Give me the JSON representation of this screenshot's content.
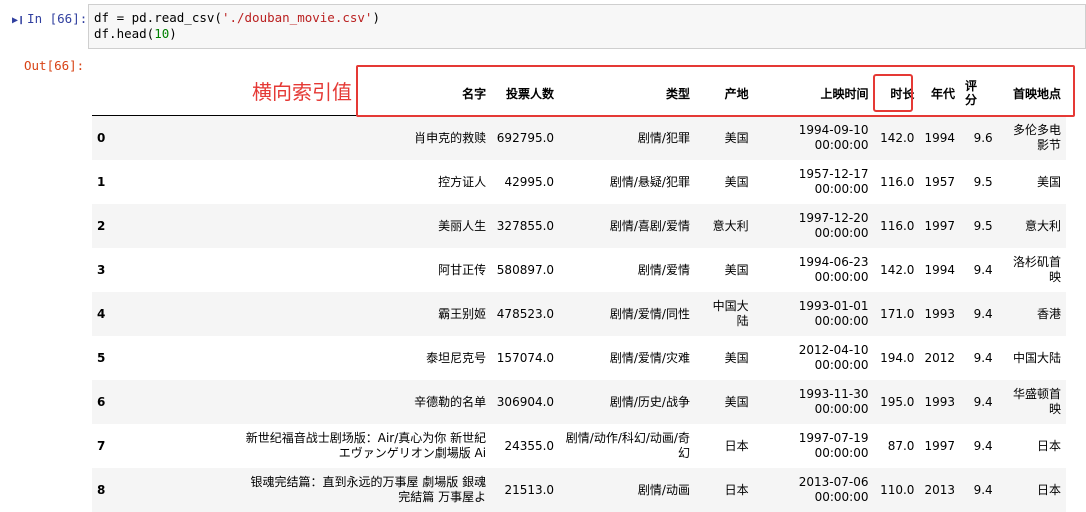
{
  "input_prompt": "In [66]:",
  "code": {
    "line1_pre": "df = pd.read_csv(",
    "line1_str": "'./douban_movie.csv'",
    "line1_post": ")",
    "line2_pre": "df.head(",
    "line2_num": "10",
    "line2_post": ")"
  },
  "output_prompt": "Out[66]:",
  "annotation": "横向索引值",
  "columns": [
    "名字",
    "投票人数",
    "类型",
    "产地",
    "上映时间",
    "时长",
    "年代",
    "评分",
    "首映地点"
  ],
  "rows": [
    {
      "idx": "0",
      "name": "肖申克的救赎",
      "votes": "692795.0",
      "genre": "剧情/犯罪",
      "origin": "美国",
      "date": "1994-09-10",
      "time": "00:00:00",
      "length": "142.0",
      "year": "1994",
      "score": "9.6",
      "premiere": "多伦多电影节"
    },
    {
      "idx": "1",
      "name": "控方证人",
      "votes": "42995.0",
      "genre": "剧情/悬疑/犯罪",
      "origin": "美国",
      "date": "1957-12-17",
      "time": "00:00:00",
      "length": "116.0",
      "year": "1957",
      "score": "9.5",
      "premiere": "美国"
    },
    {
      "idx": "2",
      "name": "美丽人生",
      "votes": "327855.0",
      "genre": "剧情/喜剧/爱情",
      "origin": "意大利",
      "date": "1997-12-20",
      "time": "00:00:00",
      "length": "116.0",
      "year": "1997",
      "score": "9.5",
      "premiere": "意大利"
    },
    {
      "idx": "3",
      "name": "阿甘正传",
      "votes": "580897.0",
      "genre": "剧情/爱情",
      "origin": "美国",
      "date": "1994-06-23",
      "time": "00:00:00",
      "length": "142.0",
      "year": "1994",
      "score": "9.4",
      "premiere": "洛杉矶首映"
    },
    {
      "idx": "4",
      "name": "霸王别姬",
      "votes": "478523.0",
      "genre": "剧情/爱情/同性",
      "origin": "中国大陆",
      "date": "1993-01-01",
      "time": "00:00:00",
      "length": "171.0",
      "year": "1993",
      "score": "9.4",
      "premiere": "香港"
    },
    {
      "idx": "5",
      "name": "泰坦尼克号",
      "votes": "157074.0",
      "genre": "剧情/爱情/灾难",
      "origin": "美国",
      "date": "2012-04-10",
      "time": "00:00:00",
      "length": "194.0",
      "year": "2012",
      "score": "9.4",
      "premiere": "中国大陆"
    },
    {
      "idx": "6",
      "name": "辛德勒的名单",
      "votes": "306904.0",
      "genre": "剧情/历史/战争",
      "origin": "美国",
      "date": "1993-11-30",
      "time": "00:00:00",
      "length": "195.0",
      "year": "1993",
      "score": "9.4",
      "premiere": "华盛顿首映"
    },
    {
      "idx": "7",
      "name": "新世纪福音战士剧场版：Air/真心为你 新世紀エヴァンゲリオン劇場版 Ai",
      "votes": "24355.0",
      "genre": "剧情/动作/科幻/动画/奇幻",
      "origin": "日本",
      "date": "1997-07-19",
      "time": "00:00:00",
      "length": "87.0",
      "year": "1997",
      "score": "9.4",
      "premiere": "日本"
    },
    {
      "idx": "8",
      "name": "银魂完结篇：直到永远的万事屋 劇場版 銀魂 完結篇 万事屋よ",
      "votes": "21513.0",
      "genre": "剧情/动画",
      "origin": "日本",
      "date": "2013-07-06",
      "time": "00:00:00",
      "length": "110.0",
      "year": "2013",
      "score": "9.4",
      "premiere": "日本"
    }
  ]
}
